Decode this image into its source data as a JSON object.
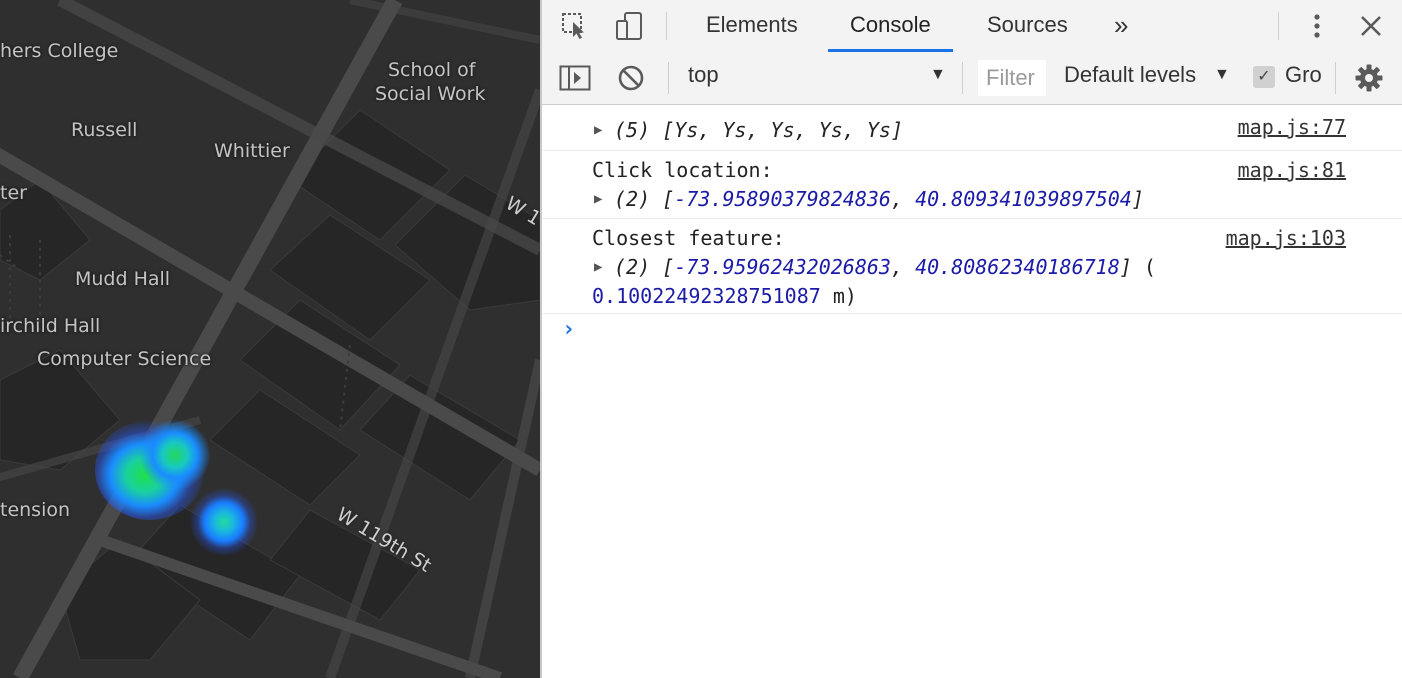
{
  "map": {
    "labels": {
      "teachers_college": "hers College",
      "school_social_work_1": "School of",
      "school_social_work_2": "Social Work",
      "russell": "Russell",
      "whittier": "Whittier",
      "center": "ter",
      "mudd_hall": "Mudd Hall",
      "fairchild_hall": "irchild Hall",
      "computer_science": "Computer Science",
      "extension": "tension",
      "street_w119": "W 119th St",
      "street_w_cut": "W 1"
    }
  },
  "devtools": {
    "tabs": [
      {
        "label": "Elements",
        "active": false
      },
      {
        "label": "Console",
        "active": true
      },
      {
        "label": "Sources",
        "active": false
      }
    ],
    "more_tabs_icon": "»",
    "toolbar": {
      "context": "top",
      "filter_placeholder": "Filter",
      "levels": "Default levels",
      "group_label": "Group similar"
    },
    "messages": [
      {
        "source": "map.js:77",
        "count": "(5)",
        "array_text": "[Ys, Ys, Ys, Ys, Ys]"
      },
      {
        "source": "map.js:81",
        "label": "Click location:",
        "count": "(2)",
        "v1": "-73.95890379824836",
        "v2": "40.809341039897504"
      },
      {
        "source": "map.js:103",
        "label": "Closest feature:",
        "count": "(2)",
        "v1": "-73.95962432026863",
        "v2": "40.80862340186718",
        "distance": "0.10022492328751087",
        "unit": "m"
      }
    ],
    "prompt_symbol": "›"
  },
  "colors": {
    "accent": "#1a73e8",
    "number": "#1b1ba8",
    "map_bg": "#2f2f2f"
  }
}
